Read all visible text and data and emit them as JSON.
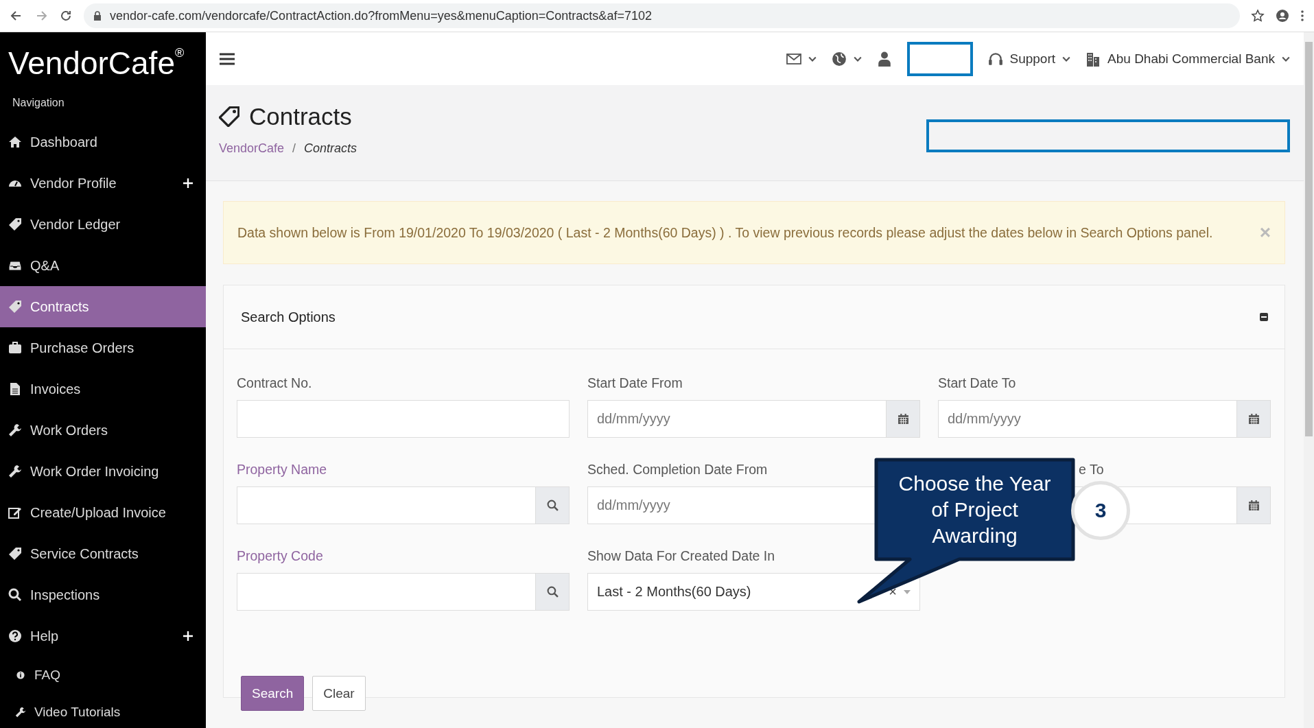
{
  "browser": {
    "url": "vendor-cafe.com/vendorcafe/ContractAction.do?fromMenu=yes&menuCaption=Contracts&af=7102"
  },
  "sidebar": {
    "logo": "VendorCafe",
    "logo_mark": "®",
    "heading": "Navigation",
    "items": [
      {
        "label": "Dashboard",
        "kind": "main",
        "selected": false,
        "expandable": false
      },
      {
        "label": "Vendor Profile",
        "kind": "main",
        "selected": false,
        "expandable": true
      },
      {
        "label": "Vendor Ledger",
        "kind": "main",
        "selected": false,
        "expandable": false
      },
      {
        "label": "Q&A",
        "kind": "main",
        "selected": false,
        "expandable": false
      },
      {
        "label": "Contracts",
        "kind": "main",
        "selected": true,
        "expandable": false
      },
      {
        "label": "Purchase Orders",
        "kind": "main",
        "selected": false,
        "expandable": false
      },
      {
        "label": "Invoices",
        "kind": "main",
        "selected": false,
        "expandable": false
      },
      {
        "label": "Work Orders",
        "kind": "main",
        "selected": false,
        "expandable": false
      },
      {
        "label": "Work Order Invoicing",
        "kind": "main",
        "selected": false,
        "expandable": false
      },
      {
        "label": "Create/Upload Invoice",
        "kind": "main",
        "selected": false,
        "expandable": false
      },
      {
        "label": "Service Contracts",
        "kind": "main",
        "selected": false,
        "expandable": false
      },
      {
        "label": "Inspections",
        "kind": "main",
        "selected": false,
        "expandable": false
      },
      {
        "label": "Help",
        "kind": "main",
        "selected": false,
        "expandable": true
      },
      {
        "label": "FAQ",
        "kind": "sub",
        "selected": false,
        "expandable": false
      },
      {
        "label": "Video Tutorials",
        "kind": "sub",
        "selected": false,
        "expandable": false
      }
    ]
  },
  "topbar": {
    "support": "Support",
    "organization": "Abu Dhabi Commercial Bank"
  },
  "page": {
    "title": "Contracts",
    "breadcrumb_separator": "/",
    "breadcrumb": [
      {
        "label": "VendorCafe",
        "kind": "link"
      },
      {
        "label": "Contracts",
        "kind": "current"
      }
    ]
  },
  "alert": {
    "text": "Data shown below is From 19/01/2020 To 19/03/2020 ( Last - 2 Months(60 Days) ) . To view previous records please adjust the dates below in Search Options panel.",
    "close": "×"
  },
  "search_options": {
    "title": "Search Options",
    "fields": [
      {
        "label": "Contract No.",
        "kind": "text"
      },
      {
        "label": "Start Date From",
        "kind": "date",
        "placeholder": "dd/mm/yyyy"
      },
      {
        "label": "Start Date To",
        "kind": "date",
        "placeholder": "dd/mm/yyyy"
      },
      {
        "label": "Property Name",
        "kind": "lookup"
      },
      {
        "label": "Sched. Completion Date From",
        "kind": "date",
        "placeholder": "dd/mm/yyyy"
      },
      {
        "label": "e To",
        "kind": "date-covered"
      },
      {
        "label": "Property Code",
        "kind": "lookup"
      },
      {
        "label": "Show Data For Created Date In",
        "kind": "select",
        "value": "Last - 2 Months(60 Days)",
        "clear": "×"
      }
    ],
    "buttons": [
      {
        "label": "Search",
        "kind": "primary"
      },
      {
        "label": "Clear",
        "kind": "default"
      }
    ]
  },
  "callout": {
    "text": "Choose the Year of Project Awarding",
    "step": "3"
  }
}
